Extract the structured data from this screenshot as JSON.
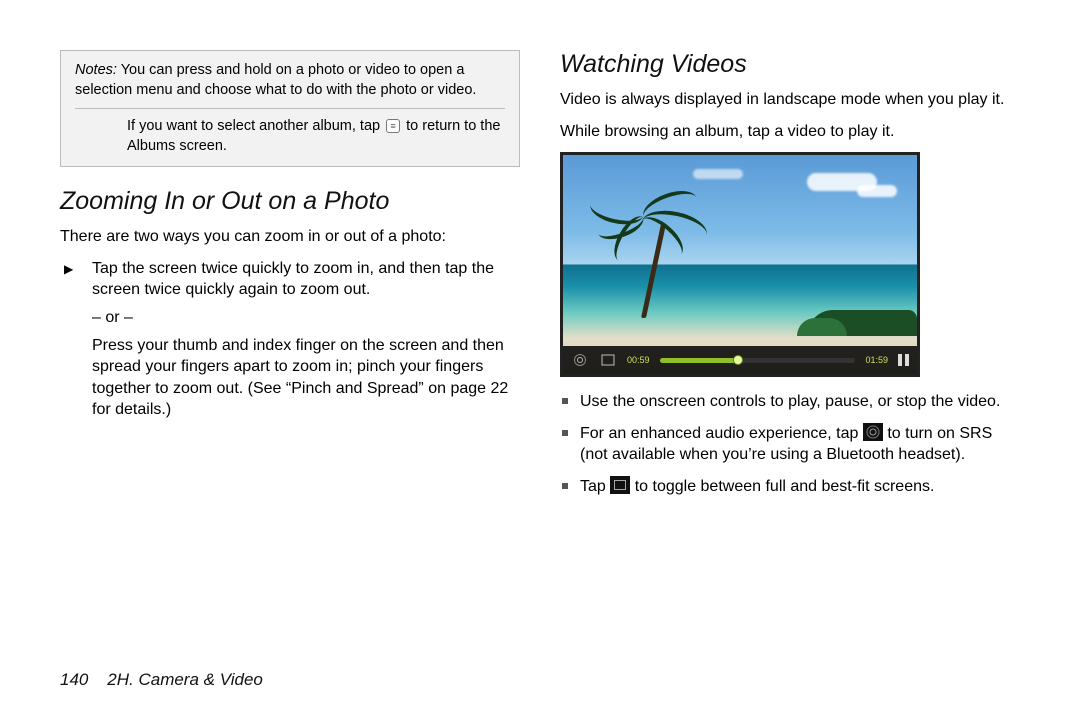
{
  "notes": {
    "label": "Notes:",
    "note1": " You can press and hold on a photo or video to open a selection menu and choose what to do with the photo or video.",
    "note2a": "If you want to select another album, tap",
    "note2b": "to return to the Albums screen."
  },
  "left": {
    "heading": "Zooming In or Out on a Photo",
    "intro": "There are two ways you can zoom in or out of a photo:",
    "bullet1a": "Tap the screen twice quickly to zoom in, and then tap the screen twice quickly again to zoom out.",
    "or": "– or –",
    "bullet1b": "Press your thumb and index finger on the screen and then spread your fingers apart to zoom in; pinch your fingers together to zoom out. (See “Pinch and Spread” on page 22 for details.)"
  },
  "right": {
    "heading": "Watching Videos",
    "p1": "Video is always displayed in landscape mode when you play it.",
    "p2": "While browsing an album, tap a video to play it.",
    "sq1": "Use the onscreen controls to play, pause, or stop the video.",
    "sq2a": "For an enhanced audio experience, tap",
    "sq2b": "to turn on SRS (not available when you’re using a Bluetooth headset).",
    "sq3a": "Tap",
    "sq3b": "to toggle between full and best-fit screens."
  },
  "player": {
    "elapsed": "00:59",
    "total": "01:59"
  },
  "footer": {
    "page": "140",
    "section": "2H. Camera & Video"
  }
}
